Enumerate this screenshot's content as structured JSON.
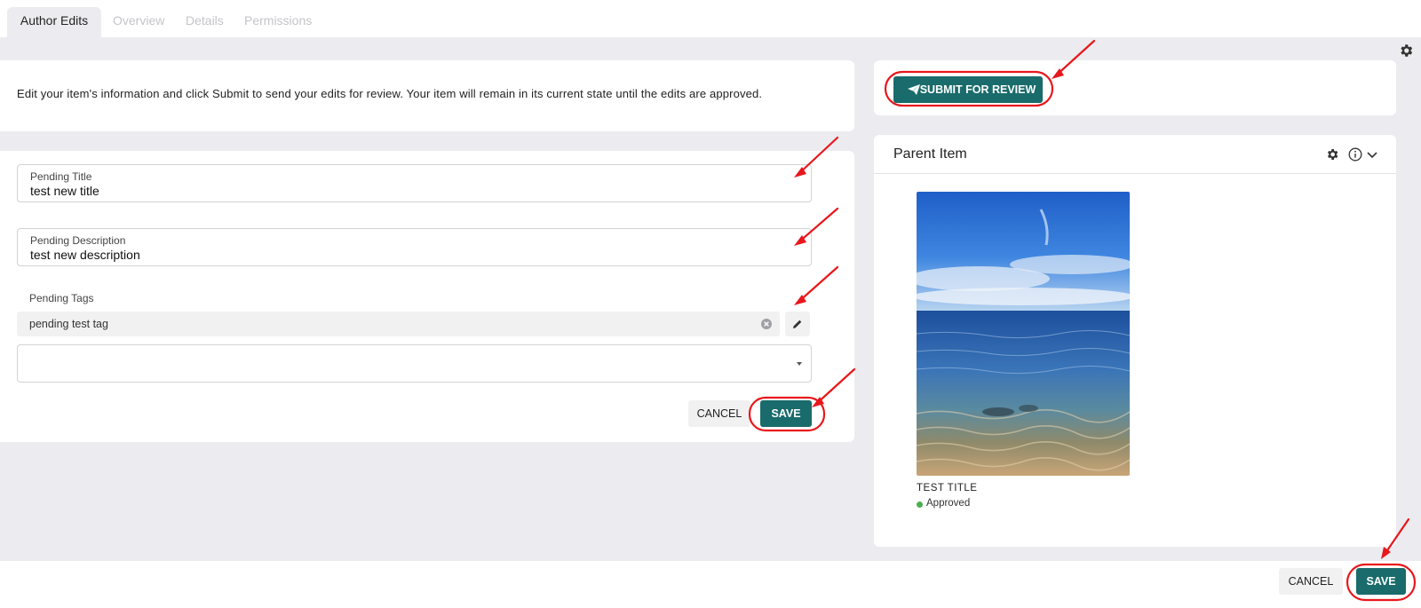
{
  "tabs": [
    {
      "label": "Author Edits",
      "active": true
    },
    {
      "label": "Overview"
    },
    {
      "label": "Details"
    },
    {
      "label": "Permissions"
    }
  ],
  "intro": {
    "text": "Edit your item's information and click Submit to send your edits for review. Your item will remain in its current state until the edits are approved."
  },
  "form": {
    "title_label": "Pending Title",
    "title_value": "test new title",
    "description_label": "Pending Description",
    "description_value": "test new description",
    "tags_label": "Pending Tags",
    "tags": [
      "pending test tag"
    ],
    "cancel_label": "CANCEL",
    "save_label": "SAVE"
  },
  "submit": {
    "label": "SUBMIT FOR REVIEW"
  },
  "parent": {
    "header": "Parent Item",
    "item_title": "TEST TITLE",
    "status": "Approved"
  },
  "footer": {
    "cancel_label": "CANCEL",
    "save_label": "SAVE"
  },
  "colors": {
    "primary": "#1a6b6b",
    "approved": "#4caf50",
    "annotation": "#e8171b"
  }
}
